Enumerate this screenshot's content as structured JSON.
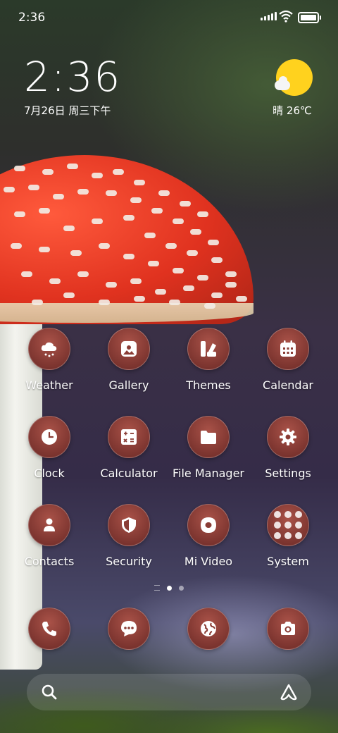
{
  "status_bar": {
    "time": "2:36",
    "battery_level": 0.85
  },
  "clock_widget": {
    "time": "2:36",
    "date": "7月26日 周三下午"
  },
  "weather_widget": {
    "text": "晴 26℃",
    "icon": "sunny-partly-cloudy-icon"
  },
  "apps": [
    {
      "label": "Weather",
      "icon": "cloud-rain-icon"
    },
    {
      "label": "Gallery",
      "icon": "image-icon"
    },
    {
      "label": "Themes",
      "icon": "themes-icon"
    },
    {
      "label": "Calendar",
      "icon": "calendar-icon"
    },
    {
      "label": "Clock",
      "icon": "clock-icon"
    },
    {
      "label": "Calculator",
      "icon": "calculator-icon"
    },
    {
      "label": "File Manager",
      "icon": "folder-icon"
    },
    {
      "label": "Settings",
      "icon": "gear-icon"
    },
    {
      "label": "Contacts",
      "icon": "person-icon"
    },
    {
      "label": "Security",
      "icon": "shield-icon"
    },
    {
      "label": "Mi Video",
      "icon": "video-icon"
    },
    {
      "label": "System",
      "icon": "folder-grid-icon"
    }
  ],
  "page_indicator": {
    "pages": 2,
    "current": 1
  },
  "dock": [
    {
      "icon": "phone-icon"
    },
    {
      "icon": "message-icon"
    },
    {
      "icon": "browser-globe-icon"
    },
    {
      "icon": "camera-icon"
    }
  ],
  "search_bar": {
    "left_icon": "search-icon",
    "right_icon": "assistant-icon"
  }
}
